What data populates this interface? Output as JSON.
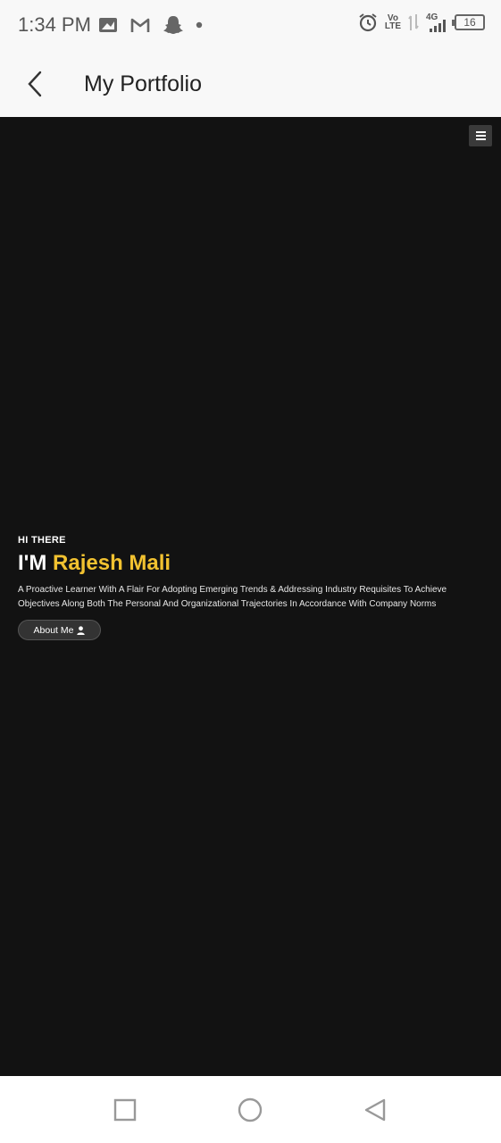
{
  "status_bar": {
    "time": "1:34 PM",
    "left_icons": [
      "photo-notification-icon",
      "gmail-icon",
      "snapchat-icon",
      "dot-icon"
    ],
    "right_icons": [
      "alarm-icon",
      "volte-icon",
      "data-arrows-icon",
      "signal-4g-icon",
      "battery-icon"
    ],
    "volte_top": "Vo",
    "volte_bottom": "LTE",
    "network": "4G",
    "battery": "16"
  },
  "app_bar": {
    "back_icon": "chevron-left-icon",
    "title": "My Portfolio"
  },
  "web": {
    "menu_icon": "hamburger-menu-icon",
    "hero": {
      "greeting": "HI THERE",
      "heading_prefix": "I'M ",
      "name": "Rajesh Mali",
      "description": "A Proactive Learner With A Flair For Adopting Emerging Trends & Addressing Industry Requisites To Achieve Objectives Along Both The Personal And Organizational Trajectories In Accordance With Company Norms",
      "about_button": "About Me",
      "about_icon": "user-icon"
    },
    "colors": {
      "background": "#121212",
      "accent": "#f2c230"
    }
  },
  "nav_bar": {
    "items": [
      "recents-square-icon",
      "home-circle-icon",
      "back-triangle-icon"
    ]
  }
}
